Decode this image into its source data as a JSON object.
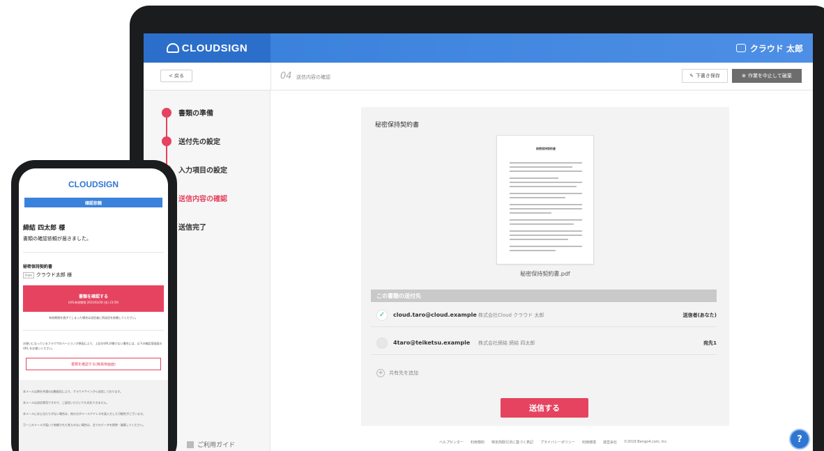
{
  "app": {
    "logo": "CLOUDSIGN",
    "user_name": "クラウド 太郎"
  },
  "toolbar": {
    "back_label": "< 戻る",
    "step_number": "04",
    "step_label": "送信内容の確認",
    "draft_label": "下書き保存",
    "abort_label": "作業を中止して破棄"
  },
  "sidebar": {
    "steps": [
      {
        "label": "書類の準備",
        "state": "done"
      },
      {
        "label": "送付先の設定",
        "state": "done"
      },
      {
        "label": "入力項目の設定",
        "state": "done"
      },
      {
        "label": "送信内容の確認",
        "state": "current"
      },
      {
        "label": "送信完了",
        "state": "future"
      }
    ],
    "guide_label": "ご利用ガイド"
  },
  "document": {
    "title": "秘密保持契約書",
    "preview_heading": "秘密保持契約書",
    "file_name": "秘密保持契約書.pdf"
  },
  "recipients": {
    "section_label": "この書類の送付先",
    "rows": [
      {
        "email": "cloud.taro@cloud.example",
        "org": "株式会社Cloud クラウド 太郎",
        "status": "送信者(あなた)",
        "checked": true
      },
      {
        "email": "4taro@teiketsu.example",
        "org": "株式会社締結 締結 四太郎",
        "status": "宛先1",
        "checked": false
      }
    ],
    "add_label": "共有先を追加"
  },
  "actions": {
    "send_label": "送信する"
  },
  "footer": {
    "links": [
      "ヘルプセンター",
      "利用規約",
      "特定商取引法に基づく表記",
      "プライバシーポリシー",
      "利用環境",
      "運営会社",
      "©2019 Bengo4.com, Inc."
    ],
    "help_icon": "?"
  },
  "phone": {
    "logo": "CLOUDSIGN",
    "banner": "確認依頼",
    "recipient_name": "締結 四太郎 様",
    "message": "書類の確認依頼が届きました。",
    "doc_title": "秘密保持契約書",
    "sender_tag": "From",
    "sender_name": "クラウド太郎 様",
    "primary_button": "書類を確認する",
    "primary_sub": "(URL有効期限 2022/02/28 (金) 23:59)",
    "note": "有効期限を過ぎてしまった場合は送信者に再送信を依頼してください。",
    "note2": "お使いになっているブラウザのバージョンが原因により、上記のURLが開けない場合には、以下の確認用画面の URL をお使いください。",
    "secondary_button": "書類を確認する(簡易用画面)",
    "grey_lines": [
      "本メールは弊社共通の自動配信により、クラウドサインから送信しております。",
      "本メールは送信専用ですので、ご返信いただいても対応できません。",
      "本メールにお心当たりがない場合は、他の方がメールアドレスを誤入力した可能性がございます。",
      "万一このメールが届いて依頼された覚えのない場合は、全てのデータを削除・破棄してください。"
    ]
  },
  "colors": {
    "brand_blue": "#2f76d2",
    "accent_red": "#e5435f",
    "success_green": "#2db36a"
  }
}
